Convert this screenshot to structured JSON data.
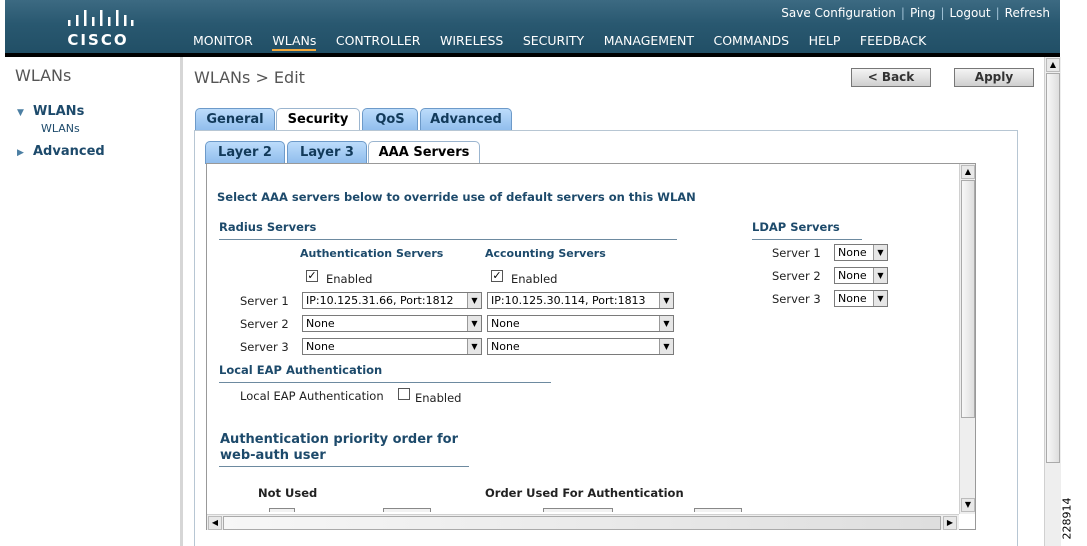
{
  "header": {
    "logo_text": "CISCO",
    "top_links": [
      "Save Configuration",
      "Ping",
      "Logout",
      "Refresh"
    ],
    "nav": [
      "MONITOR",
      "WLANs",
      "CONTROLLER",
      "WIRELESS",
      "SECURITY",
      "MANAGEMENT",
      "COMMANDS",
      "HELP",
      "FEEDBACK"
    ],
    "active_nav": "WLANs"
  },
  "sidebar": {
    "title": "WLANs",
    "items": [
      {
        "label": "WLANs",
        "expanded": true,
        "children": [
          "WLANs"
        ]
      },
      {
        "label": "Advanced",
        "expanded": false
      }
    ]
  },
  "main": {
    "title": "WLANs > Edit",
    "back_label": "< Back",
    "apply_label": "Apply",
    "tabs": [
      "General",
      "Security",
      "QoS",
      "Advanced"
    ],
    "active_tab": "Security",
    "subtabs": [
      "Layer 2",
      "Layer 3",
      "AAA Servers"
    ],
    "active_subtab": "AAA Servers",
    "intro": "Select AAA servers below to override use of default servers on this WLAN",
    "radius": {
      "title": "Radius Servers",
      "auth_header": "Authentication Servers",
      "acct_header": "Accounting Servers",
      "enabled_label": "Enabled",
      "auth_enabled": true,
      "acct_enabled": true,
      "rows": [
        {
          "label": "Server 1",
          "auth": "IP:10.125.31.66, Port:1812",
          "acct": "IP:10.125.30.114, Port:1813"
        },
        {
          "label": "Server 2",
          "auth": "None",
          "acct": "None"
        },
        {
          "label": "Server 3",
          "auth": "None",
          "acct": "None"
        }
      ]
    },
    "ldap": {
      "title": "LDAP Servers",
      "rows": [
        {
          "label": "Server 1",
          "value": "None"
        },
        {
          "label": "Server 2",
          "value": "None"
        },
        {
          "label": "Server 3",
          "value": "None"
        }
      ]
    },
    "local_eap": {
      "title": "Local EAP Authentication",
      "label": "Local EAP Authentication",
      "enabled_label": "Enabled",
      "enabled": false
    },
    "priority": {
      "title_line1": "Authentication priority order for",
      "title_line2": "web-auth user",
      "not_used": "Not Used",
      "order_used": "Order Used For Authentication"
    }
  },
  "figure_id": "228914",
  "colors": {
    "header": "#295870",
    "tab": "#8fbcec",
    "section_text": "#1d4a6b",
    "nav_active": "#f2a83a"
  }
}
